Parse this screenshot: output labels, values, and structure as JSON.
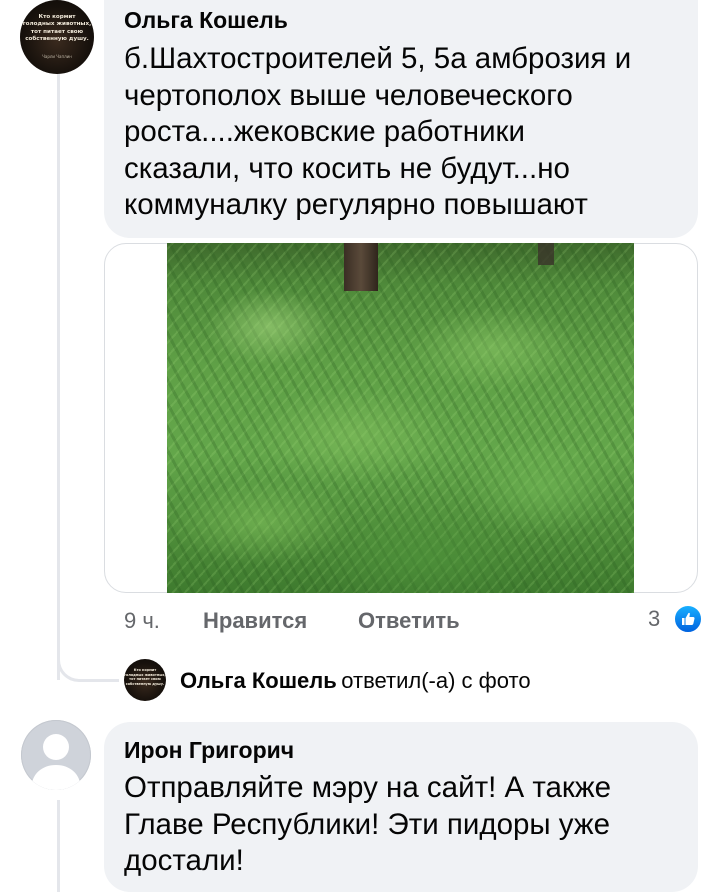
{
  "comment1": {
    "author": "Ольга Кошель",
    "lines": [
      "б.Шахтостроителей 5, 5а амброзия и",
      "чертополох выше человеческого",
      "роста....жековские работники",
      "сказали, что косить не будут...но",
      "коммуналку регулярно повышают"
    ],
    "avatar_text": [
      "Кто кормит",
      "голодных животных,",
      "тот питает свою",
      "собственную душу."
    ],
    "avatar_caption": "Чарли Чаплин",
    "time": "9 ч.",
    "like_label": "Нравится",
    "reply_label": "Ответить",
    "reaction_count": "3",
    "reaction_icon": "like-thumb-icon"
  },
  "reply_summary": {
    "author": "Ольга Кошель",
    "action": "ответил(-а) с фото"
  },
  "comment2": {
    "author": "Ирон Григорич",
    "lines": [
      "Отправляйте мэру на сайт! А также",
      "Главе Республики! Эти пидоры уже",
      "достали!"
    ]
  },
  "colors": {
    "bubble": "#f0f2f5",
    "meta_text": "#65676b",
    "like_blue": "#1877f2",
    "thread_line": "#e4e6eb"
  }
}
